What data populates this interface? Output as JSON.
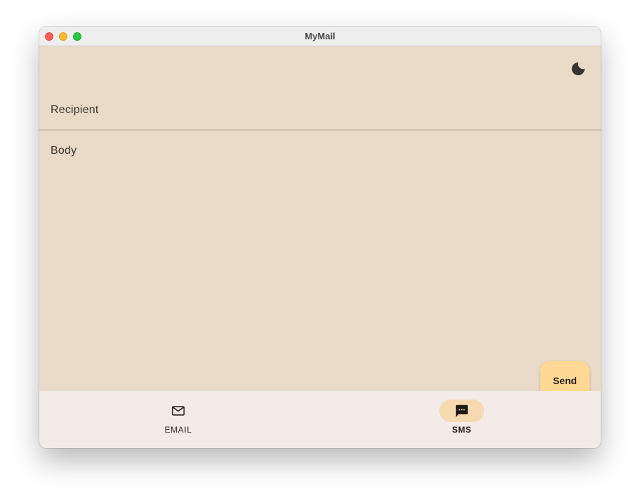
{
  "window": {
    "title": "MyMail"
  },
  "toolbar": {
    "theme_icon": "moon-icon"
  },
  "compose": {
    "recipient_placeholder": "Recipient",
    "body_placeholder": "Body",
    "send_label": "Send"
  },
  "bottom_nav": {
    "items": [
      {
        "label": "EMAIL",
        "icon": "mail-icon",
        "selected": false
      },
      {
        "label": "SMS",
        "icon": "chat-icon",
        "selected": true
      }
    ]
  },
  "colors": {
    "background": "#eadbc8",
    "nav_background": "#f3ebe8",
    "send_button": "#ffd893",
    "selected_indicator": "#f5d9b1"
  }
}
